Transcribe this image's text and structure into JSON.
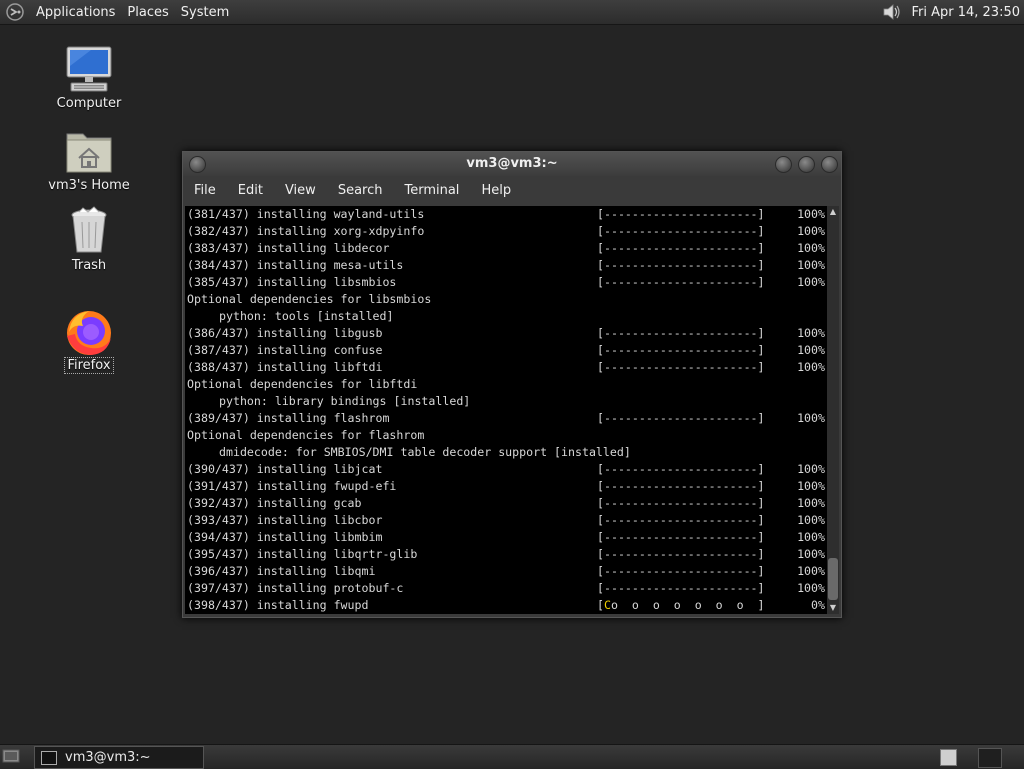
{
  "top_panel": {
    "menus": [
      "Applications",
      "Places",
      "System"
    ],
    "clock": "Fri Apr 14, 23:50"
  },
  "desktop_icons": [
    {
      "label": "Computer"
    },
    {
      "label": "vm3's Home"
    },
    {
      "label": "Trash"
    },
    {
      "label": "Firefox"
    }
  ],
  "terminal": {
    "title": "vm3@vm3:~",
    "menus": [
      "File",
      "Edit",
      "View",
      "Search",
      "Terminal",
      "Help"
    ],
    "lines": [
      {
        "text": "(381/437) installing wayland-utils",
        "bar": "[----------------------]",
        "pct": "100%"
      },
      {
        "text": "(382/437) installing xorg-xdpyinfo",
        "bar": "[----------------------]",
        "pct": "100%"
      },
      {
        "text": "(383/437) installing libdecor",
        "bar": "[----------------------]",
        "pct": "100%"
      },
      {
        "text": "(384/437) installing mesa-utils",
        "bar": "[----------------------]",
        "pct": "100%"
      },
      {
        "text": "(385/437) installing libsmbios",
        "bar": "[----------------------]",
        "pct": "100%"
      },
      {
        "text": "Optional dependencies for libsmbios"
      },
      {
        "sub": "python: tools [installed]"
      },
      {
        "text": "(386/437) installing libgusb",
        "bar": "[----------------------]",
        "pct": "100%"
      },
      {
        "text": "(387/437) installing confuse",
        "bar": "[----------------------]",
        "pct": "100%"
      },
      {
        "text": "(388/437) installing libftdi",
        "bar": "[----------------------]",
        "pct": "100%"
      },
      {
        "text": "Optional dependencies for libftdi"
      },
      {
        "sub": "python: library bindings [installed]"
      },
      {
        "text": "(389/437) installing flashrom",
        "bar": "[----------------------]",
        "pct": "100%"
      },
      {
        "text": "Optional dependencies for flashrom"
      },
      {
        "sub": "dmidecode: for SMBIOS/DMI table decoder support [installed]"
      },
      {
        "text": "(390/437) installing libjcat",
        "bar": "[----------------------]",
        "pct": "100%"
      },
      {
        "text": "(391/437) installing fwupd-efi",
        "bar": "[----------------------]",
        "pct": "100%"
      },
      {
        "text": "(392/437) installing gcab",
        "bar": "[----------------------]",
        "pct": "100%"
      },
      {
        "text": "(393/437) installing libcbor",
        "bar": "[----------------------]",
        "pct": "100%"
      },
      {
        "text": "(394/437) installing libmbim",
        "bar": "[----------------------]",
        "pct": "100%"
      },
      {
        "text": "(395/437) installing libqrtr-glib",
        "bar": "[----------------------]",
        "pct": "100%"
      },
      {
        "text": "(396/437) installing libqmi",
        "bar": "[----------------------]",
        "pct": "100%"
      },
      {
        "text": "(397/437) installing protobuf-c",
        "bar": "[----------------------]",
        "pct": "100%"
      },
      {
        "text": "(398/437) installing fwupd",
        "bar_cursor": "C",
        "bar": "o  o  o  o  o  o  o  ]",
        "pct": "0%"
      }
    ]
  },
  "taskbar": {
    "task_label": "vm3@vm3:~"
  }
}
